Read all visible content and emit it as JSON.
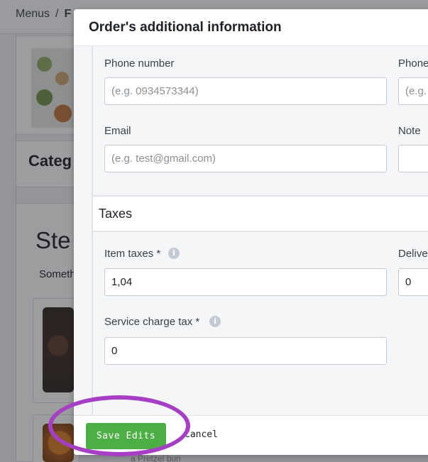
{
  "background": {
    "breadcrumb": {
      "root": "Menus",
      "separator": "/",
      "current": "F"
    },
    "category_partial": "Categ",
    "section_title_partial": "Ste",
    "section_subtitle_partial": "Someth",
    "item_description_partial": "a Pretzel bun"
  },
  "modal": {
    "title": "Order's additional information",
    "contact": {
      "phone_label": "Phone number",
      "phone_placeholder": "(e.g. 0934573344)",
      "phone2_label": "Phone",
      "phone2_placeholder": "(e.g.",
      "email_label": "Email",
      "email_placeholder": "(e.g. test@gmail.com)",
      "note_label": "Note"
    },
    "taxes": {
      "title": "Taxes",
      "item_taxes_label": "Item taxes *",
      "item_taxes_value": "1,04",
      "delivery_label": "Delive",
      "delivery_value": "0",
      "service_charge_label": "Service charge tax *",
      "service_charge_value": "0"
    },
    "footer": {
      "save_label": "Save Edits",
      "cancel_label": "Cancel"
    }
  },
  "colors": {
    "primary_button": "#4caf45",
    "annotation": "#a63fc4"
  },
  "icons": {
    "info": "info-icon"
  }
}
